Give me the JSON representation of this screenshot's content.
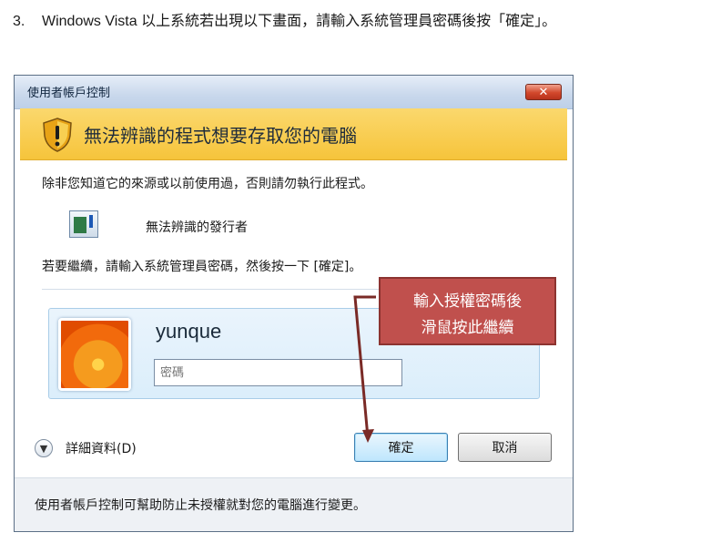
{
  "step": {
    "number": "3.",
    "text": "Windows Vista 以上系統若出現以下畫面，請輸入系統管理員密碼後按「確定」。"
  },
  "dialog": {
    "title": "使用者帳戶控制",
    "close_glyph": "✕",
    "banner_icon": "shield-warning-icon",
    "banner_text": "無法辨識的程式想要存取您的電腦",
    "description": "除非您知道它的來源或以前使用過，否則請勿執行此程式。",
    "publisher_icon": "program-icon",
    "publisher": "無法辨識的發行者",
    "instruction": "若要繼續，請輸入系統管理員密碼，然後按一下 [確定]。",
    "credential": {
      "avatar_icon": "user-avatar-flower",
      "username": "yunque",
      "password_placeholder": "密碼"
    },
    "details_icon": "chevron-down-icon",
    "details_label": "詳細資料(D)",
    "ok_label": "確定",
    "cancel_label": "取消",
    "footer_text": "使用者帳戶控制可幫助防止未授權就對您的電腦進行變更。"
  },
  "callout": {
    "line1": "輸入授權密碼後",
    "line2": "滑鼠按此繼續",
    "color": "#c0504d"
  }
}
